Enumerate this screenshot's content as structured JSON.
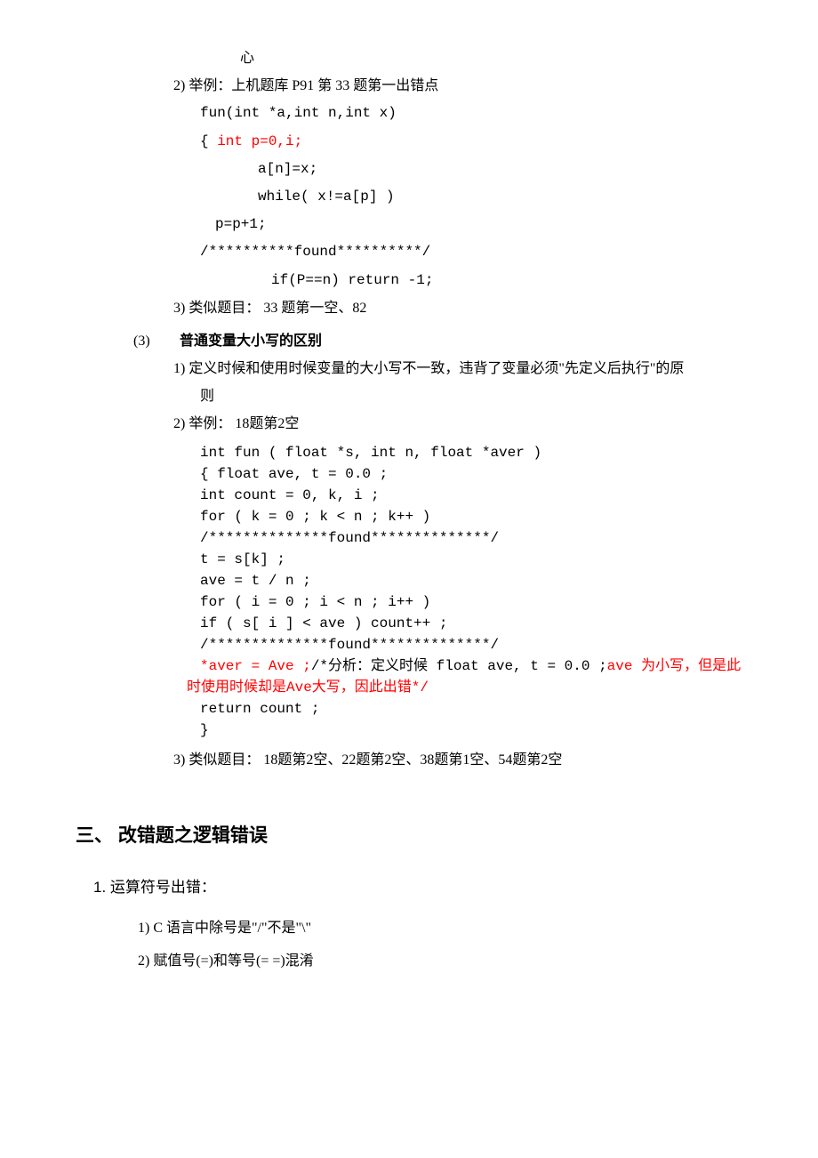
{
  "block1": {
    "a": "心",
    "b1": "2) 举例：上机题库 P91 第 33 题第一出错点",
    "c1": "fun(int *a,int n,int x)",
    "c2a": "{ ",
    "c2b": "int p=0,i;",
    "c3": "a[n]=x;",
    "c4": "while( x!=a[p] )",
    "c5": "p=p+1;",
    "c6": "/**********found**********/",
    "c7": "if(P==n) return -1;",
    "b3": "3) 类似题目： 33 题第一空、82"
  },
  "block2": {
    "title_num": "(3)",
    "title_txt": "普通变量大小写的区别",
    "p1_a": "1) 定义时候和使用时候变量的大小写不一致，违背了变量必须\"先定义后执行\"的原",
    "p1_b": "则",
    "p2": "2) 举例： 18题第2空",
    "c": {
      "l1": "int fun ( float *s, int n, float *aver )",
      "l2": "{ float ave, t = 0.0 ;",
      "l3": "  int count = 0, k, i ;",
      "l4": "  for ( k = 0 ; k < n ; k++ )",
      "l5": "/**************found**************/",
      "l6": "    t = s[k] ;",
      "l7": "  ave = t / n ;",
      "l8": "  for ( i = 0 ; i < n ; i++ )",
      "l9": "    if ( s[ i ] < ave ) count++ ;",
      "l10": "/**************found**************/",
      "l11a": "  *aver = Ave ;",
      "l11b": "/*分析：定义时候 float ave, t = 0.0 ;",
      "l11c": "ave ",
      "l11d": "为小写，但是此",
      "l12": "时使用时候却是Ave大写，因此出错*/",
      "l13": "  return count ;",
      "l14": "}"
    },
    "p3": "3) 类似题目： 18题第2空、22题第2空、38题第1空、54题第2空"
  },
  "section3": {
    "title": "三、 改错题之逻辑错误",
    "sub": "1. 运算符号出错：",
    "i1": "1)  C 语言中除号是\"/\"不是\"\\\"",
    "i2": "2)  赋值号(=)和等号(= =)混淆"
  }
}
